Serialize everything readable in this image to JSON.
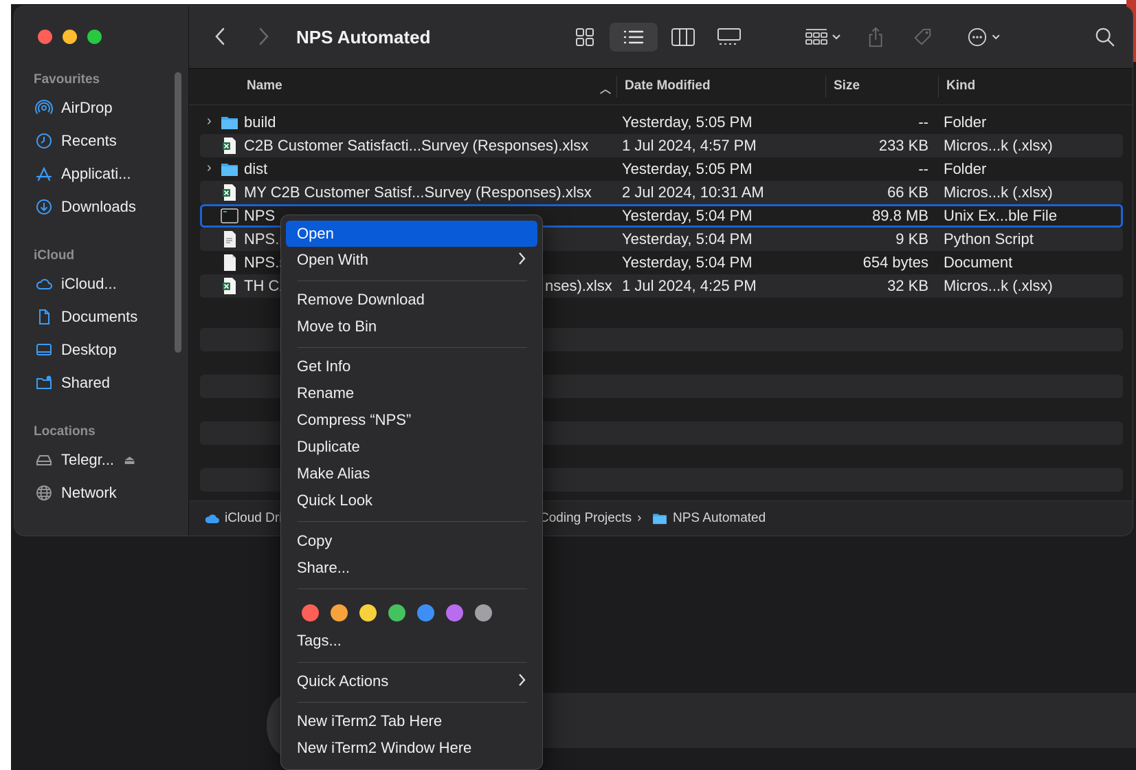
{
  "window": {
    "title": "NPS Automated"
  },
  "sidebar": {
    "sections": [
      {
        "title": "Favourites",
        "items": [
          {
            "label": "AirDrop",
            "icon": "airdrop-icon"
          },
          {
            "label": "Recents",
            "icon": "clock-icon"
          },
          {
            "label": "Applicati...",
            "icon": "applications-icon"
          },
          {
            "label": "Downloads",
            "icon": "download-icon"
          }
        ]
      },
      {
        "title": "iCloud",
        "items": [
          {
            "label": "iCloud...",
            "icon": "cloud-icon"
          },
          {
            "label": "Documents",
            "icon": "document-icon"
          },
          {
            "label": "Desktop",
            "icon": "desktop-icon"
          },
          {
            "label": "Shared",
            "icon": "shared-folder-icon"
          }
        ]
      },
      {
        "title": "Locations",
        "items": [
          {
            "label": "Telegr...",
            "icon": "drive-icon"
          },
          {
            "label": "Network",
            "icon": "globe-icon"
          }
        ]
      }
    ]
  },
  "columns": {
    "name": "Name",
    "date": "Date Modified",
    "size": "Size",
    "kind": "Kind"
  },
  "files": [
    {
      "name": "build",
      "date": "Yesterday, 5:05 PM",
      "size": "--",
      "kind": "Folder",
      "type": "folder"
    },
    {
      "name": "C2B Customer Satisfacti...Survey (Responses).xlsx",
      "date": "1 Jul 2024, 4:57 PM",
      "size": "233 KB",
      "kind": "Micros...k (.xlsx)",
      "type": "xlsx"
    },
    {
      "name": "dist",
      "date": "Yesterday, 5:05 PM",
      "size": "--",
      "kind": "Folder",
      "type": "folder"
    },
    {
      "name": "MY C2B Customer Satisf...Survey (Responses).xlsx",
      "date": "2 Jul 2024, 10:31 AM",
      "size": "66 KB",
      "kind": "Micros...k (.xlsx)",
      "type": "xlsx"
    },
    {
      "name": "NPS",
      "date": "Yesterday, 5:04 PM",
      "size": "89.8 MB",
      "kind": "Unix Ex...ble File",
      "type": "exec"
    },
    {
      "name": "NPS.py",
      "date": "Yesterday, 5:04 PM",
      "size": "9 KB",
      "kind": "Python Script",
      "type": "doc"
    },
    {
      "name": "NPS.sp",
      "date": "Yesterday, 5:04 PM",
      "size": "654 bytes",
      "kind": "Document",
      "type": "doc"
    },
    {
      "name": "TH C2...nses).xlsx",
      "name_left": "TH C2",
      "name_right": "nses).xlsx",
      "date": "1 Jul 2024, 4:25 PM",
      "size": "32 KB",
      "kind": "Micros...k (.xlsx)",
      "type": "xlsx"
    }
  ],
  "pathbar": {
    "root": "iCloud Driv",
    "mid": "Coding Projects",
    "sep": "›",
    "current": "NPS Automated"
  },
  "context_menu": {
    "items": {
      "open": "Open",
      "open_with": "Open With",
      "remove_download": "Remove Download",
      "move_to_bin": "Move to Bin",
      "get_info": "Get Info",
      "rename": "Rename",
      "compress": "Compress “NPS”",
      "duplicate": "Duplicate",
      "make_alias": "Make Alias",
      "quick_look": "Quick Look",
      "copy": "Copy",
      "share": "Share...",
      "tags": "Tags...",
      "quick_actions": "Quick Actions",
      "iterm_tab": "New iTerm2 Tab Here",
      "iterm_window": "New iTerm2 Window Here"
    },
    "tag_colors": [
      "#fe5f57",
      "#f7a23b",
      "#f7d13b",
      "#44c25f",
      "#3d8ff5",
      "#b96cf0",
      "#a0a0a4"
    ]
  },
  "colors": {
    "accent": "#0a5bd8",
    "selection_outline": "#1a63d6",
    "folder": "#39a8f0"
  }
}
